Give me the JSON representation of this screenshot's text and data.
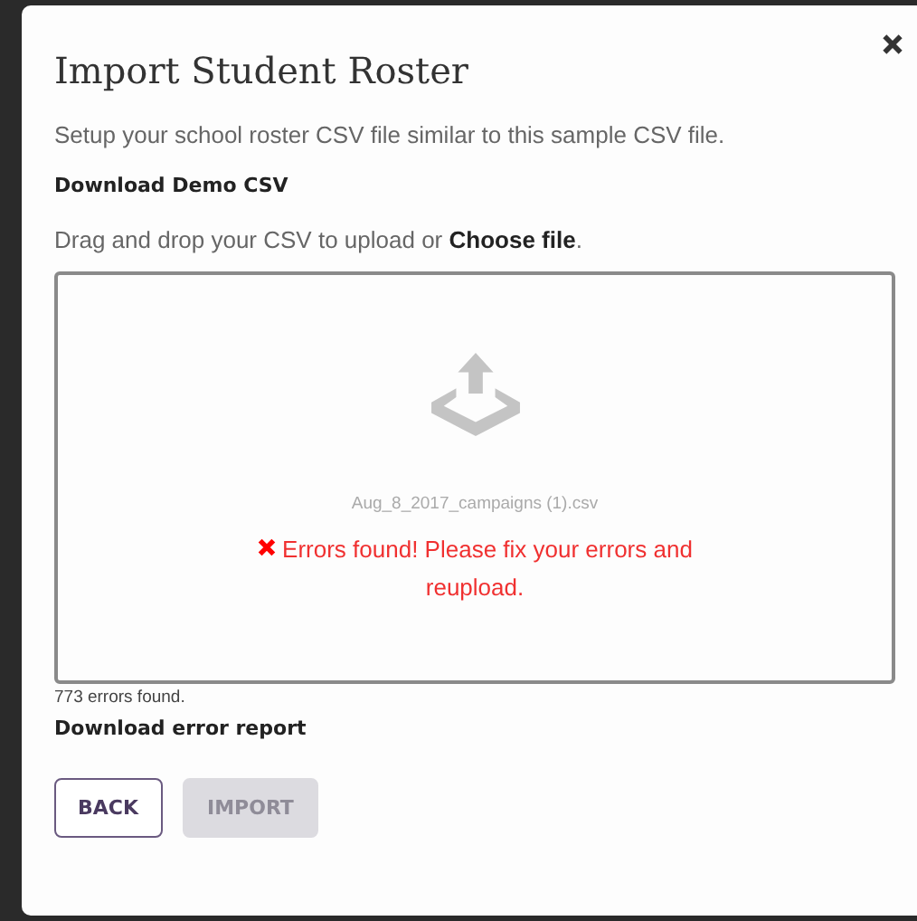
{
  "dialog": {
    "title": "Import Student Roster"
  },
  "intro": "Setup your school roster CSV file similar to this sample CSV file.",
  "demo_link": "Download Demo CSV",
  "drag_text": "Drag and drop your CSV to upload or **Choose file**.",
  "dropzone": {
    "filename": "Aug_8_2017_campaigns (1).csv",
    "error_message": "Errors found! Please fix your errors and reupload."
  },
  "error_count": "773 errors found.",
  "error_report_link": "Download error report",
  "buttons": [
    {
      "label": "BACK",
      "disabled": false
    },
    {
      "label": "IMPORT",
      "disabled": true
    }
  ]
}
